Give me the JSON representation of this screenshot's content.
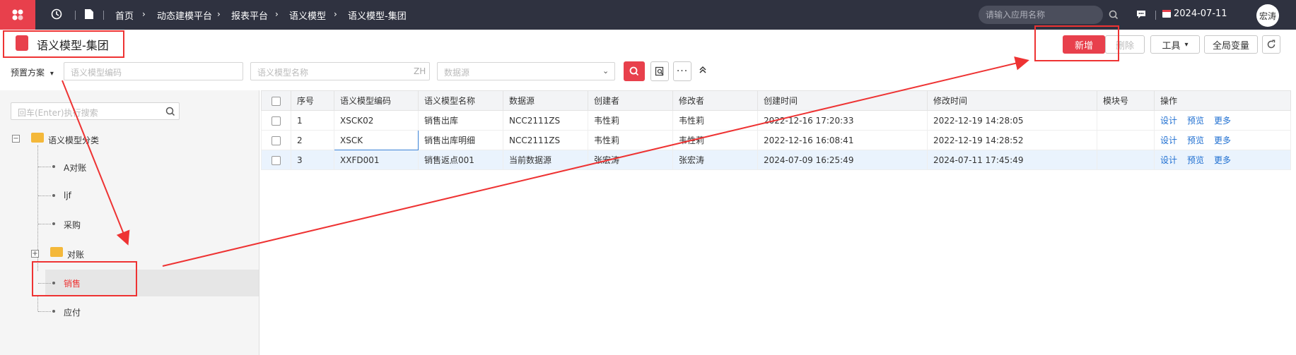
{
  "topbar": {
    "breadcrumbs": [
      "首页",
      "动态建模平台",
      "报表平台",
      "语义模型",
      "语义模型-集团"
    ],
    "search_placeholder": "请输入应用名称",
    "date": "2024-07-11",
    "user": "宏涛"
  },
  "page": {
    "title": "语义模型-集团"
  },
  "toolbar": {
    "add_label": "新增",
    "delete_label": "删除",
    "tools_label": "工具",
    "globals_label": "全局变量"
  },
  "filters": {
    "scheme_label": "预置方案",
    "code_placeholder": "语义模型编码",
    "name_placeholder": "语义模型名称",
    "name_suffix": "ZH",
    "datasource_placeholder": "数据源"
  },
  "tree": {
    "search_placeholder": "回车(Enter)执行搜索",
    "root": "语义模型分类",
    "items": [
      "A对账",
      "ljf",
      "采购",
      "对账",
      "销售",
      "应付"
    ]
  },
  "table": {
    "columns": [
      "序号",
      "语义模型编码",
      "语义模型名称",
      "数据源",
      "创建者",
      "修改者",
      "创建时间",
      "修改时间",
      "模块号",
      "操作"
    ],
    "rows": [
      {
        "no": "1",
        "code": "XSCK02",
        "name": "销售出库",
        "ds": "NCC2111ZS",
        "creator": "韦性莉",
        "modifier": "韦性莉",
        "created": "2022-12-16 17:20:33",
        "modified": "2022-12-19 14:28:05",
        "module": ""
      },
      {
        "no": "2",
        "code": "XSCK",
        "name": "销售出库明细",
        "ds": "NCC2111ZS",
        "creator": "韦性莉",
        "modifier": "韦性莉",
        "created": "2022-12-16 16:08:41",
        "modified": "2022-12-19 14:28:52",
        "module": ""
      },
      {
        "no": "3",
        "code": "XXFD001",
        "name": "销售返点001",
        "ds": "当前数据源",
        "creator": "张宏涛",
        "modifier": "张宏涛",
        "created": "2024-07-09 16:25:49",
        "modified": "2024-07-11 17:45:49",
        "module": ""
      }
    ],
    "ops": [
      "设计",
      "预览",
      "更多"
    ]
  },
  "colors": {
    "accent": "#e8404c",
    "topbar": "#2f3240",
    "link": "#1f6fd1",
    "annotation": "#e33333"
  }
}
